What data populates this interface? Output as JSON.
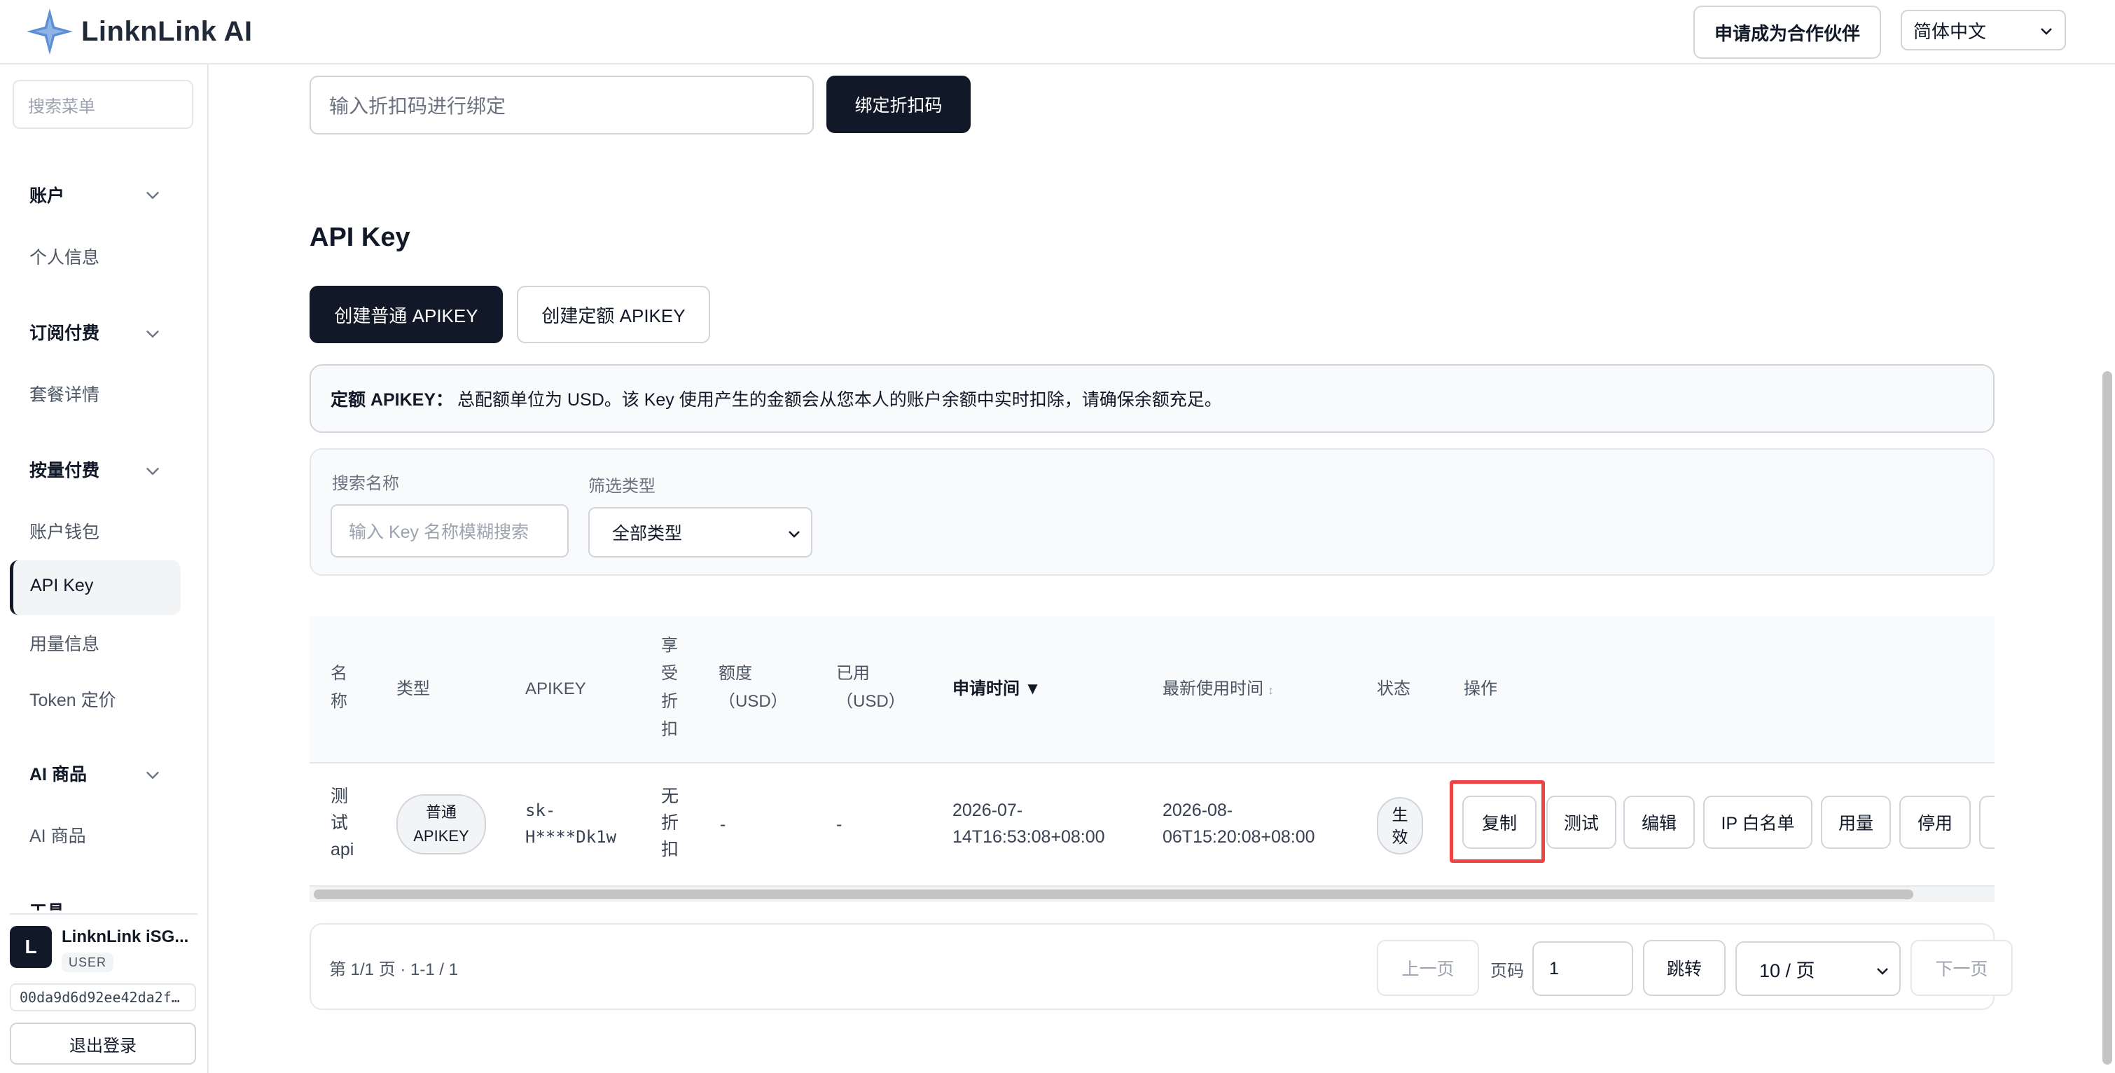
{
  "header": {
    "brand": "LinknLink AI",
    "partner_button": "申请成为合作伙伴",
    "language": "简体中文"
  },
  "sidebar": {
    "search_placeholder": "搜索菜单",
    "groups": [
      {
        "label": "账户",
        "items": [
          "个人信息"
        ]
      },
      {
        "label": "订阅付费",
        "items": [
          "套餐详情"
        ]
      },
      {
        "label": "按量付费",
        "items": [
          "账户钱包",
          "API Key",
          "用量信息",
          "Token 定价"
        ]
      },
      {
        "label": "AI 商品",
        "items": [
          "AI 商品"
        ]
      },
      {
        "label": "工具",
        "items": []
      }
    ],
    "active_item": "API Key",
    "user": {
      "avatar_letter": "L",
      "name": "LinknLink iSG...",
      "role": "USER",
      "id": "00da9d6d92ee42da2f…"
    },
    "logout": "退出登录"
  },
  "discount": {
    "placeholder": "输入折扣码进行绑定",
    "bind_button": "绑定折扣码"
  },
  "apikey": {
    "title": "API Key",
    "create_normal": "创建普通 APIKEY",
    "create_fixed": "创建定额 APIKEY",
    "notice_label": "定额 APIKEY：",
    "notice_text": "总配额单位为 USD。该 Key 使用产生的金额会从您本人的账户余额中实时扣除，请确保余额充足。"
  },
  "filters": {
    "name_label": "搜索名称",
    "name_placeholder": "输入 Key 名称模糊搜索",
    "type_label": "筛选类型",
    "type_value": "全部类型"
  },
  "table": {
    "headers": {
      "name": [
        "名",
        "称"
      ],
      "type": "类型",
      "apikey": "APIKEY",
      "discount": [
        "享",
        "受",
        "折",
        "扣"
      ],
      "quota": [
        "额度",
        "（USD）"
      ],
      "used": [
        "已用",
        "（USD）"
      ],
      "apply_time": "申请时间 ▼",
      "last_used": "最新使用时间",
      "last_used_sort": "↕",
      "status": "状态",
      "actions": "操作"
    },
    "rows": [
      {
        "name": [
          "测",
          "试",
          "api"
        ],
        "type": [
          "普通",
          "APIKEY"
        ],
        "apikey": [
          "sk-",
          "H****Dk1w"
        ],
        "discount": [
          "无",
          "折",
          "扣"
        ],
        "quota": "-",
        "used": "-",
        "apply_time": [
          "2026-07-",
          "14T16:53:08+08:00"
        ],
        "last_used": [
          "2026-08-",
          "06T15:20:08+08:00"
        ],
        "status": [
          "生",
          "效"
        ],
        "actions": [
          "复制",
          "测试",
          "编辑",
          "IP 白名单",
          "用量",
          "停用"
        ]
      }
    ]
  },
  "pagination": {
    "info": "第 1/1 页 · 1-1 / 1",
    "prev": "上一页",
    "page_label": "页码",
    "page_value": "1",
    "jump": "跳转",
    "page_size": "10 / 页",
    "next": "下一页"
  }
}
